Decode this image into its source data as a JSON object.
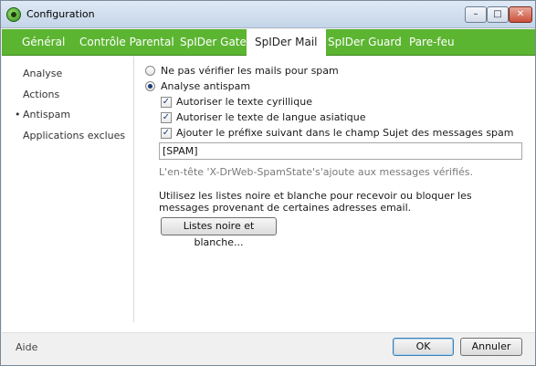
{
  "window": {
    "title": "Configuration",
    "app_icon": "spider-icon"
  },
  "title_buttons": {
    "minimize": "–",
    "maximize": "□",
    "close": "✕"
  },
  "tabs": [
    {
      "label": "Général"
    },
    {
      "label": "Contrôle Parental"
    },
    {
      "label": "SpIDer Gate"
    },
    {
      "label": "SpIDer Mail",
      "active": true
    },
    {
      "label": "SpIDer Guard"
    },
    {
      "label": "Pare-feu"
    }
  ],
  "sidebar": {
    "items": [
      {
        "label": "Analyse"
      },
      {
        "label": "Actions"
      },
      {
        "label": "Antispam",
        "active": true
      },
      {
        "label": "Applications exclues"
      }
    ]
  },
  "antispam": {
    "radio_no_check": {
      "label": "Ne pas vérifier les mails pour spam",
      "selected": false
    },
    "radio_analyse": {
      "label": "Analyse antispam",
      "selected": true
    },
    "chk_cyrillic": {
      "label": "Autoriser le texte cyrillique",
      "checked": true
    },
    "chk_asian": {
      "label": "Autoriser le texte de langue asiatique",
      "checked": true
    },
    "chk_prefix": {
      "label": "Ajouter le préfixe suivant dans le champ Sujet des messages spam",
      "checked": true
    },
    "prefix_value": "[SPAM]",
    "hint": "L'en-tête 'X-DrWeb-SpamState's'ajoute aux messages vérifiés.",
    "lists_text": "Utilisez les listes noire et blanche pour recevoir ou bloquer les messages provenant de certaines adresses email.",
    "lists_button": "Listes noire et blanche..."
  },
  "footer": {
    "help": "Aide",
    "ok": "OK",
    "cancel": "Annuler"
  },
  "colors": {
    "tab_bar": "#5cb531",
    "accent_border": "#3c7fb1"
  }
}
